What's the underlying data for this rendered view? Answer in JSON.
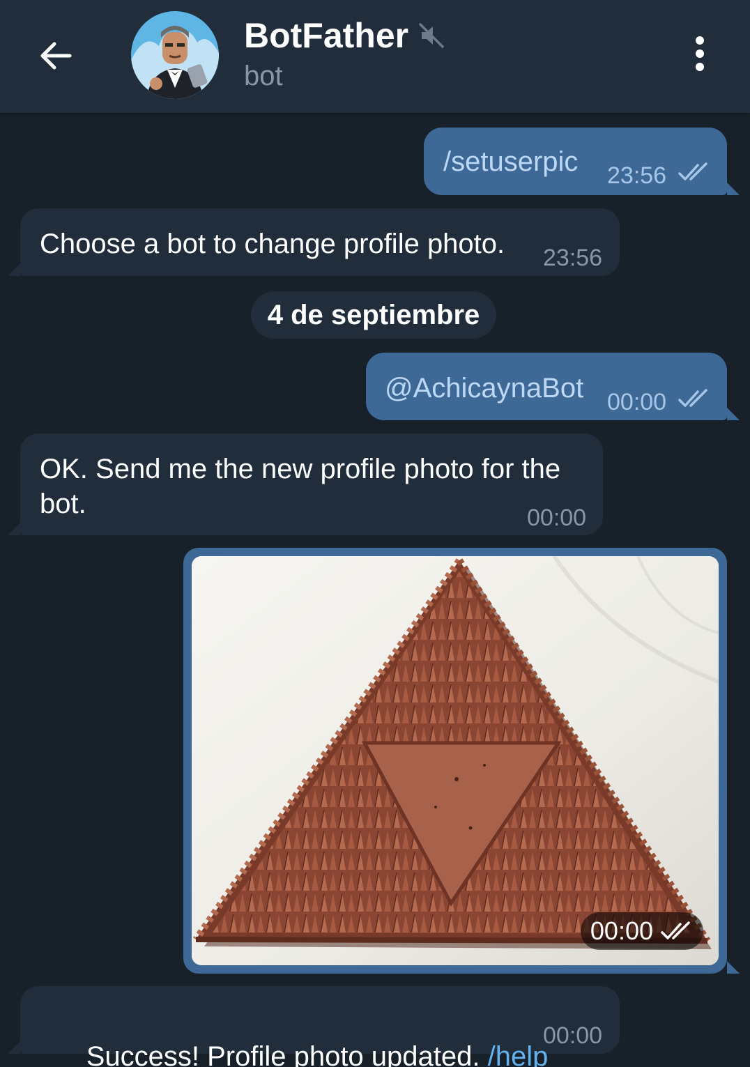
{
  "header": {
    "title": "BotFather",
    "subtitle": "bot",
    "avatar_icon": "botfather-avatar",
    "muted_icon": "muted-speaker-icon",
    "back_icon": "arrow-left-icon",
    "menu_icon": "more-vertical-icon"
  },
  "colors": {
    "background": "#18202a",
    "header": "#212d3b",
    "outgoing_bubble": "#3e6896",
    "incoming_bubble": "#212d3b",
    "link": "#62b3f0"
  },
  "messages": [
    {
      "direction": "out",
      "text": "/setuserpic",
      "time": "23:56",
      "status": "read"
    },
    {
      "direction": "in",
      "text": "Choose a bot to change profile photo.",
      "time": "23:56"
    },
    {
      "direction": "date",
      "text": "4 de septiembre"
    },
    {
      "direction": "out",
      "text": "@AchicaynaBot",
      "time": "00:00",
      "status": "read"
    },
    {
      "direction": "in",
      "text_line1": "OK. Send me the new profile photo for the",
      "text_line2": "bot.",
      "time": "00:00"
    },
    {
      "direction": "out",
      "type": "photo",
      "photo_subject": "terracotta-triangle-triforce",
      "time": "00:00",
      "status": "read"
    },
    {
      "direction": "in",
      "text": "Success! Profile photo updated. ",
      "link": "/help",
      "time": "00:00"
    }
  ]
}
